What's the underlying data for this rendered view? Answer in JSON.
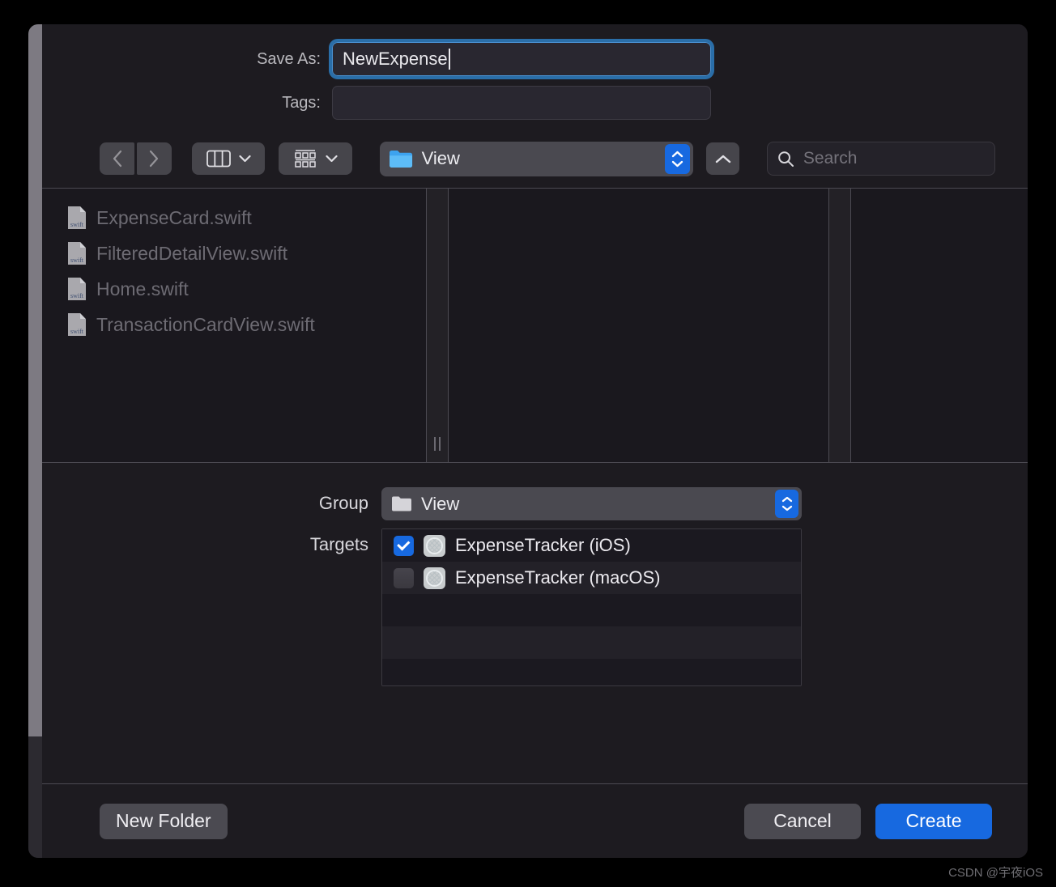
{
  "dialog": {
    "save_as_label": "Save As:",
    "save_as_value": "NewExpense",
    "tags_label": "Tags:",
    "tags_value": ""
  },
  "toolbar": {
    "back_icon": "chevron-left-icon",
    "forward_icon": "chevron-right-icon",
    "column_view_icon": "column-view-icon",
    "gallery_view_icon": "gallery-view-icon",
    "path_label": "View",
    "path_folder_icon": "folder-icon",
    "up_icon": "chevron-up-icon",
    "search_placeholder": "Search",
    "search_value": "",
    "search_icon": "search-icon"
  },
  "browser": {
    "files": [
      {
        "name": "ExpenseCard.swift",
        "icon": "swift-file-icon",
        "tag": "swift"
      },
      {
        "name": "FilteredDetailView.swift",
        "icon": "swift-file-icon",
        "tag": "swift"
      },
      {
        "name": "Home.swift",
        "icon": "swift-file-icon",
        "tag": "swift"
      },
      {
        "name": "TransactionCardView.swift",
        "icon": "swift-file-icon",
        "tag": "swift"
      }
    ]
  },
  "accessory": {
    "group_label": "Group",
    "group_value": "View",
    "targets_label": "Targets",
    "targets": [
      {
        "name": "ExpenseTracker (iOS)",
        "checked": true
      },
      {
        "name": "ExpenseTracker (macOS)",
        "checked": false
      },
      {
        "name": "",
        "checked": false
      },
      {
        "name": "",
        "checked": false
      },
      {
        "name": "",
        "checked": false
      }
    ]
  },
  "buttons": {
    "new_folder": "New Folder",
    "cancel": "Cancel",
    "create": "Create"
  },
  "watermark": "CSDN @宇夜iOS",
  "colors": {
    "accent_blue": "#1769e0",
    "focus_ring": "#2a6ea8",
    "dialog_bg": "#1d1b20",
    "control_gray": "#4b4a51"
  }
}
